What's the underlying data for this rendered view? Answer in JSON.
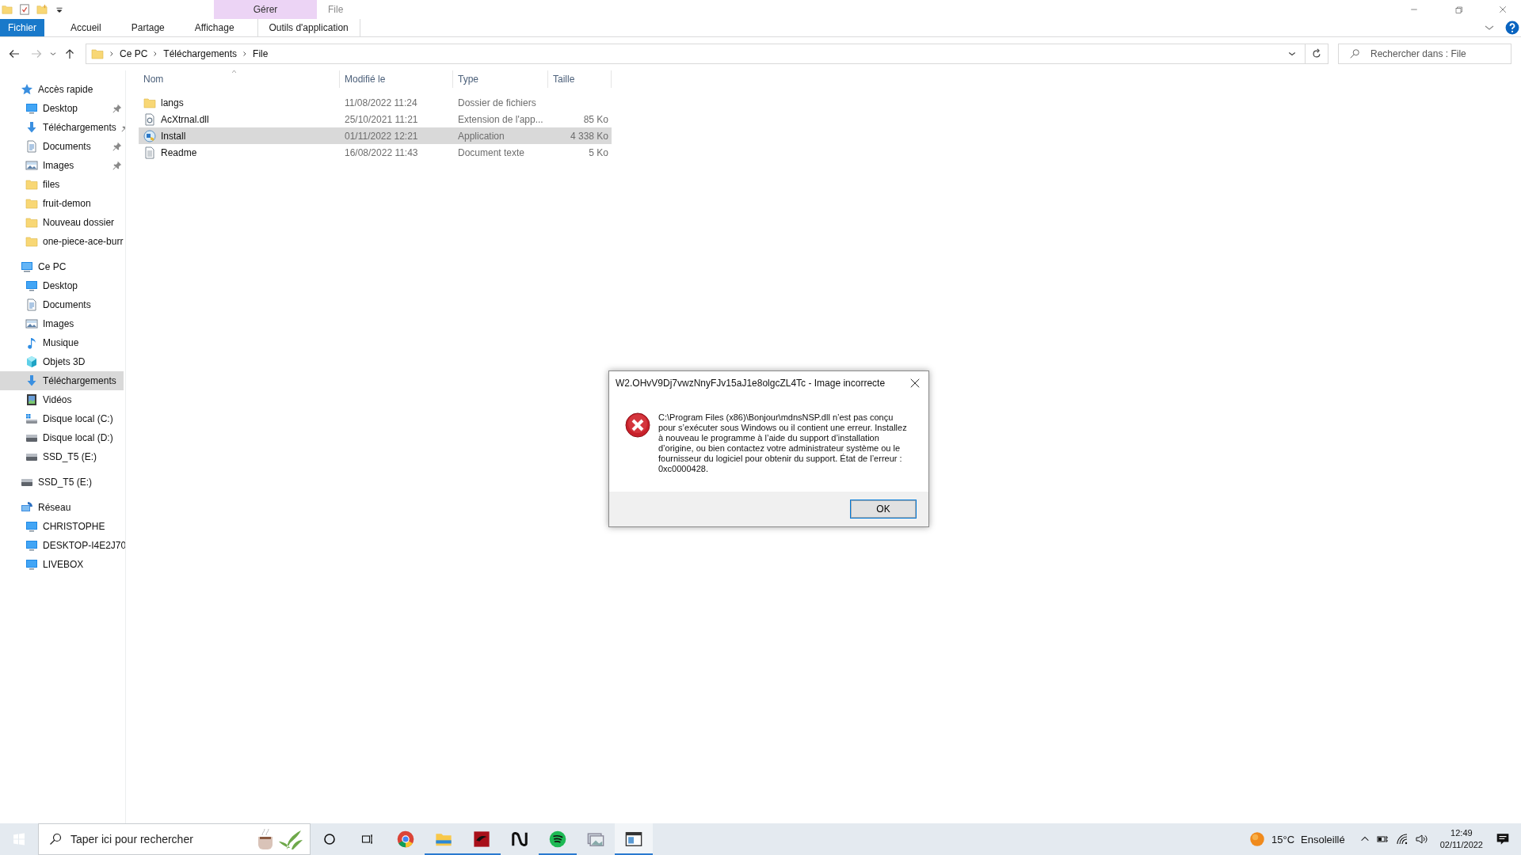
{
  "window": {
    "title": "File",
    "context_header": "Gérer"
  },
  "quick_access_toolbar": [
    {
      "kind": "folder"
    },
    {
      "kind": "properties"
    },
    {
      "kind": "newfolder"
    },
    {
      "kind": "dropdown"
    }
  ],
  "ribbon_tabs": [
    {
      "label": "Fichier",
      "kind": "file",
      "selected": false
    },
    {
      "label": "Accueil",
      "kind": "normal",
      "selected": false
    },
    {
      "label": "Partage",
      "kind": "normal",
      "selected": false
    },
    {
      "label": "Affichage",
      "kind": "normal",
      "selected": false
    },
    {
      "label": "Outils d'application",
      "kind": "contextual",
      "selected": false
    }
  ],
  "address_bar": {
    "path": [
      "Ce PC",
      "Téléchargements",
      "File"
    ]
  },
  "search": {
    "placeholder": "Rechercher dans : File"
  },
  "sidebar": [
    {
      "label": "Accès rapide",
      "kind": "star",
      "selected": false,
      "children": [
        {
          "label": "Desktop",
          "kind": "desktop",
          "selected": false,
          "pinned": true
        },
        {
          "label": "Téléchargements",
          "kind": "download",
          "selected": false,
          "pinned": true
        },
        {
          "label": "Documents",
          "kind": "document",
          "selected": false,
          "pinned": true
        },
        {
          "label": "Images",
          "kind": "image",
          "selected": false,
          "pinned": true
        },
        {
          "label": "files",
          "kind": "folder",
          "selected": false,
          "pinned": false
        },
        {
          "label": "fruit-demon",
          "kind": "folder",
          "selected": false,
          "pinned": false
        },
        {
          "label": "Nouveau dossier",
          "kind": "folder",
          "selected": false,
          "pinned": false
        },
        {
          "label": "one-piece-ace-burr",
          "kind": "folder",
          "selected": false,
          "pinned": false
        }
      ]
    },
    {
      "label": "Ce PC",
      "kind": "computer",
      "selected": false,
      "children": [
        {
          "label": "Desktop",
          "kind": "desktop",
          "selected": false
        },
        {
          "label": "Documents",
          "kind": "document",
          "selected": false
        },
        {
          "label": "Images",
          "kind": "image",
          "selected": false
        },
        {
          "label": "Musique",
          "kind": "music",
          "selected": false
        },
        {
          "label": "Objets 3D",
          "kind": "cube",
          "selected": false
        },
        {
          "label": "Téléchargements",
          "kind": "download",
          "selected": true
        },
        {
          "label": "Vidéos",
          "kind": "film",
          "selected": false
        },
        {
          "label": "Disque local (C:)",
          "kind": "sysdrive",
          "selected": false
        },
        {
          "label": "Disque local (D:)",
          "kind": "drive",
          "selected": false
        },
        {
          "label": "SSD_T5 (E:)",
          "kind": "drive",
          "selected": false
        }
      ]
    },
    {
      "label": "SSD_T5 (E:)",
      "kind": "drive",
      "selected": false
    },
    {
      "label": "Réseau",
      "kind": "network",
      "selected": false,
      "children": [
        {
          "label": "CHRISTOPHE",
          "kind": "desktop",
          "selected": false
        },
        {
          "label": "DESKTOP-I4E2J70",
          "kind": "desktop",
          "selected": false
        },
        {
          "label": "LIVEBOX",
          "kind": "desktop",
          "selected": false
        }
      ]
    }
  ],
  "table": {
    "columns": [
      {
        "label": "Nom",
        "sorted": true
      },
      {
        "label": "Modifié le",
        "sorted": false
      },
      {
        "label": "Type",
        "sorted": false
      },
      {
        "label": "Taille",
        "sorted": false
      }
    ],
    "rows": [
      {
        "kind": "folder",
        "name": "langs",
        "modified": "11/08/2022 11:24",
        "type": "Dossier de fichiers",
        "selected": false
      },
      {
        "kind": "dll",
        "name": "AcXtrnal.dll",
        "modified": "25/10/2021 11:21",
        "type": "Extension de l'app...",
        "size": "85 Ko",
        "selected": false
      },
      {
        "kind": "app",
        "name": "Install",
        "modified": "01/11/2022 12:21",
        "type": "Application",
        "size": "4 338 Ko",
        "selected": true
      },
      {
        "kind": "text",
        "name": "Readme",
        "modified": "16/08/2022 11:43",
        "type": "Document texte",
        "size": "5 Ko",
        "selected": false
      }
    ]
  },
  "dialog": {
    "title": "W2.OHvV9Dj7vwzNnyFJv15aJ1e8olgcZL4Tc - Image incorrecte",
    "message": "C:\\Program Files (x86)\\Bonjour\\mdnsNSP.dll n’est pas conçu pour s’exécuter sous Windows ou il contient une erreur. Installez à nouveau le programme à l’aide du support d’installation d’origine, ou bien contactez votre administrateur système ou le fournisseur du logiciel pour obtenir du support. État de l’erreur : 0xc0000428.",
    "buttons": [
      "OK"
    ]
  },
  "taskbar": {
    "search_placeholder": "Taper ici pour rechercher",
    "apps": [
      {
        "kind": "browser",
        "running": false,
        "active": false
      },
      {
        "kind": "explorer",
        "running": true,
        "active": false
      },
      {
        "kind": "redsquare",
        "running": true,
        "active": false
      },
      {
        "kind": "wave",
        "running": false,
        "active": false
      },
      {
        "kind": "music",
        "running": true,
        "active": false
      },
      {
        "kind": "photos",
        "running": false,
        "active": false
      },
      {
        "kind": "window",
        "running": true,
        "active": true
      }
    ],
    "weather": {
      "temperature": "15°C",
      "condition": "Ensoleillé"
    },
    "time": "12:49",
    "date": "02/11/2022"
  }
}
